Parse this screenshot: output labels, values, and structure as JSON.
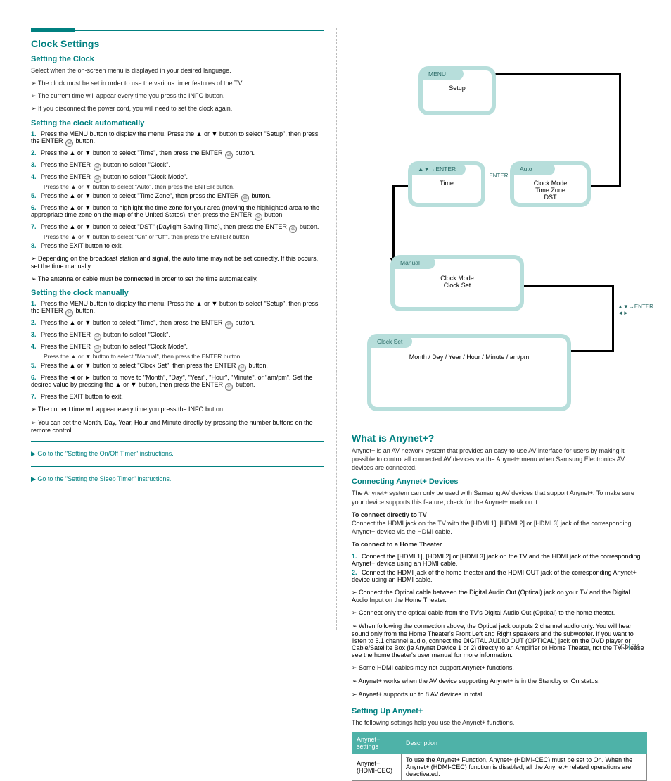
{
  "left": {
    "h1": "Clock Settings",
    "h2": "Setting the Clock",
    "autoTitle": "Setting the clock automatically",
    "p1": "Select when the on-screen menu is displayed in your desired language.",
    "p2": "The clock must be set in order to use the various timer features of the TV.",
    "p3": "The current time will appear every time you press the INFO button.",
    "p4": "If you disconnect the power cord, you will need to set the clock again.",
    "steps1": [
      {
        "n": "1.",
        "t": "Press the MENU button to display the menu. Press the ▲ or ▼ button to select \"Setup\", then press the ENTER",
        "icon": "enter",
        "after": " button."
      },
      {
        "n": "2.",
        "t": "Press the ▲ or ▼ button to select \"Time\", then press the ENTER",
        "icon": "enter",
        "after": " button."
      },
      {
        "n": "3.",
        "t": "Press the ENTER",
        "icon": "enter",
        "after": " button to select \"Clock\"."
      },
      {
        "n": "4.",
        "t": "Press the ENTER",
        "icon": "enter",
        "after": " button to select \"Clock Mode\".",
        "sub": "Press the ▲ or ▼ button to select \"Auto\", then press the ENTER button."
      },
      {
        "n": "5.",
        "t": "Press the ▲ or ▼ button to select \"Time Zone\", then press the ENTER",
        "icon": "enter",
        "after": " button."
      },
      {
        "n": "6.",
        "t": "Press the ▲ or ▼ button to highlight the time zone for your area (moving the highlighted area to the appropriate time zone on the map of the United States), then press the ENTER",
        "icon": "enter",
        "after": " button."
      },
      {
        "n": "7.",
        "t": "Press the ▲ or ▼ button to select \"DST\" (Daylight Saving Time), then press the ENTER",
        "icon": "enter",
        "after": " button.",
        "sub": "Press the ▲ or ▼ button to select \"On\" or \"Off\", then press the ENTER button."
      },
      {
        "n": "8.",
        "t": "Press the EXIT button to exit."
      }
    ],
    "notes1": [
      "Depending on the broadcast station and signal, the auto time may not be set correctly. If this occurs, set the time manually.",
      "The antenna or cable must be connected in order to set the time automatically."
    ],
    "manualTitle": "Setting the clock manually",
    "steps2": [
      {
        "n": "1.",
        "t": "Press the MENU button to display the menu. Press the ▲ or ▼ button to select \"Setup\", then press the ENTER",
        "icon": "enter",
        "after": " button."
      },
      {
        "n": "2.",
        "t": "Press the ▲ or ▼ button to select \"Time\", then press the ENTER",
        "icon": "enter",
        "after": " button."
      },
      {
        "n": "3.",
        "t": "Press the ENTER",
        "icon": "enter",
        "after": " button to select \"Clock\"."
      },
      {
        "n": "4.",
        "t": "Press the ENTER",
        "icon": "enter",
        "after": " button to select \"Clock Mode\".",
        "sub": "Press the ▲ or ▼ button to select \"Manual\", then press the ENTER button."
      },
      {
        "n": "5.",
        "t": "Press the ▲ or ▼ button to select \"Clock Set\", then press the ENTER",
        "icon": "enter",
        "after": " button."
      },
      {
        "n": "6.",
        "t": "Press the ◄ or ► button to move to \"Month\", \"Day\", \"Year\", \"Hour\", \"Minute\", or \"am/pm\". Set the desired value by pressing the ▲ or ▼ button, then press the ENTER",
        "icon": "enter",
        "after": " button."
      },
      {
        "n": "7.",
        "t": "Press the EXIT button to exit."
      }
    ],
    "notes2": [
      "The current time will appear every time you press the INFO button.",
      "You can set the Month, Day, Year, Hour and Minute directly by pressing the number buttons on the remote control."
    ],
    "links": [
      "Go to the \"Setting the On/Off Timer\" instructions.",
      "Go to the \"Setting the Sleep Timer\" instructions."
    ]
  },
  "right": {
    "flow": {
      "b1": {
        "tab": "MENU",
        "text": "Setup"
      },
      "b2": {
        "tab": "▲▼→ENTER",
        "text": "Time"
      },
      "b3": {
        "tab": "Auto",
        "text": "Clock Mode\nTime Zone\nDST"
      },
      "b4": {
        "tab": "Manual",
        "text": "Clock Mode\nClock Set"
      },
      "b5": {
        "tab": "Clock Set",
        "text": "Month / Day / Year / Hour / Minute / am/pm"
      },
      "sideLabel": "▲▼→ENTER\n◄►",
      "split": "ENTER"
    },
    "anynet": {
      "title": "What is Anynet+?",
      "p1": "Anynet+ is an AV network system that provides an easy-to-use AV interface for users by making it possible to control all connected AV devices via the Anynet+ menu when Samsung Electronics AV devices are connected.",
      "subtitle": "Connecting Anynet+ Devices",
      "p2": "The Anynet+ system can only be used with Samsung AV devices that support Anynet+. To make sure your device supports this feature, check for the Anynet+ mark on it.",
      "p3_label": "To connect directly to TV",
      "p3": "Connect the HDMI jack on the TV with the [HDMI 1], [HDMI 2] or [HDMI 3] jack of the corresponding Anynet+ device via the HDMI cable.",
      "p4_label": "To connect to a Home Theater",
      "steps": [
        {
          "n": "1.",
          "t": "Connect the [HDMI 1], [HDMI 2] or [HDMI 3] jack on the TV and the HDMI jack of the corresponding Anynet+ device using an HDMI cable."
        },
        {
          "n": "2.",
          "t": "Connect the HDMI jack of the home theater and the HDMI OUT jack of the corresponding Anynet+ device using an HDMI cable."
        }
      ],
      "notes": [
        "Connect the Optical cable between the Digital Audio Out (Optical) jack on your TV and the Digital Audio Input on the Home Theater.",
        "Connect only the optical cable from the TV's Digital Audio Out (Optical) to the home theater.",
        "When following the connection above, the Optical jack outputs 2 channel audio only. You will hear sound only from the Home Theater's Front Left and Right speakers and the subwoofer. If you want to listen to 5.1 channel audio, connect the DIGITAL AUDIO OUT (OPTICAL) jack on the DVD player or Cable/Satellite Box (ie Anynet Device 1 or 2) directly to an Amplifier or Home Theater, not the TV. Please see the home theater's user manual for more information.",
        "Some HDMI cables may not support Anynet+ functions.",
        "Anynet+ works when the AV device supporting Anynet+ is in the Standby or On status.",
        "Anynet+ supports up to 8 AV devices in total."
      ],
      "setupTitle": "Setting Up Anynet+",
      "setupP": "The following settings help you use the Anynet+ functions.",
      "tableHeaders": [
        "Anynet+ settings",
        "Description"
      ],
      "tableRow": [
        "Anynet+ (HDMI-CEC)",
        "To use the Anynet+ Function, Anynet+ (HDMI-CEC) must be set to On. When the Anynet+ (HDMI-CEC) function is disabled, all the Anynet+ related operations are deactivated."
      ]
    }
  },
  "pageNumbers": [
    "33",
    "34"
  ]
}
